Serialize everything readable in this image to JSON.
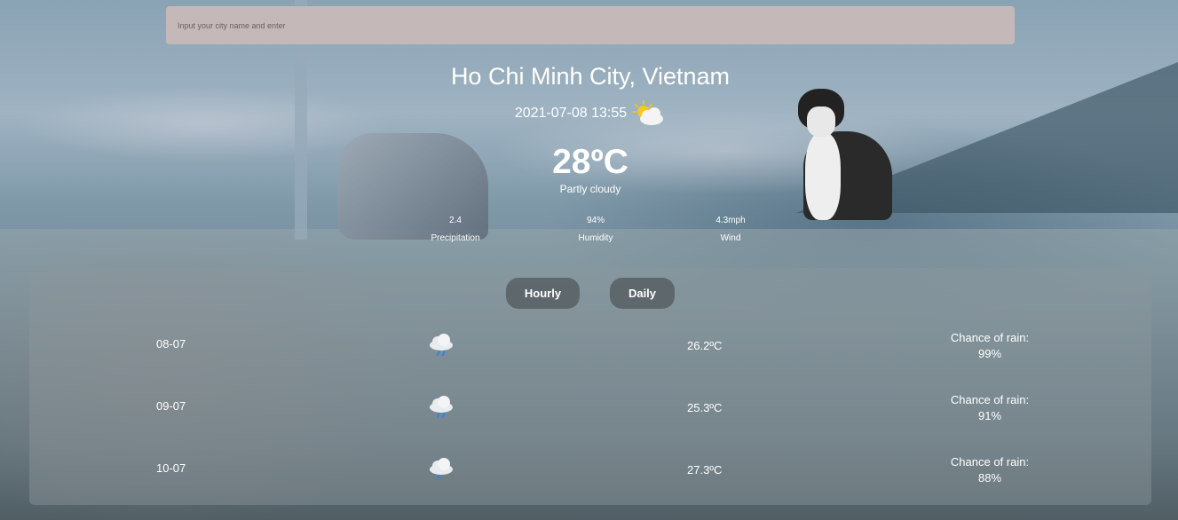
{
  "search": {
    "placeholder": "Input your city name and enter"
  },
  "current": {
    "location": "Ho Chi Minh City, Vietnam",
    "datetime": "2021-07-08 13:55",
    "icon": "partly-cloudy-icon",
    "temperature": "28ºC",
    "condition": "Partly cloudy"
  },
  "stats": {
    "precipitation": {
      "value": "2.4",
      "label": "Precipitation"
    },
    "humidity": {
      "value": "94%",
      "label": "Humidity"
    },
    "wind": {
      "value": "4.3mph",
      "label": "Wind"
    }
  },
  "tabs": {
    "hourly": "Hourly",
    "daily": "Daily"
  },
  "rain_label": "Chance of rain:",
  "forecast": [
    {
      "date": "08-07",
      "icon": "rain-cloud-icon",
      "temp": "26.2ºC",
      "rain": "99%"
    },
    {
      "date": "09-07",
      "icon": "rain-cloud-icon",
      "temp": "25.3ºC",
      "rain": "91%"
    },
    {
      "date": "10-07",
      "icon": "rain-cloud-icon",
      "temp": "27.3ºC",
      "rain": "88%"
    }
  ]
}
